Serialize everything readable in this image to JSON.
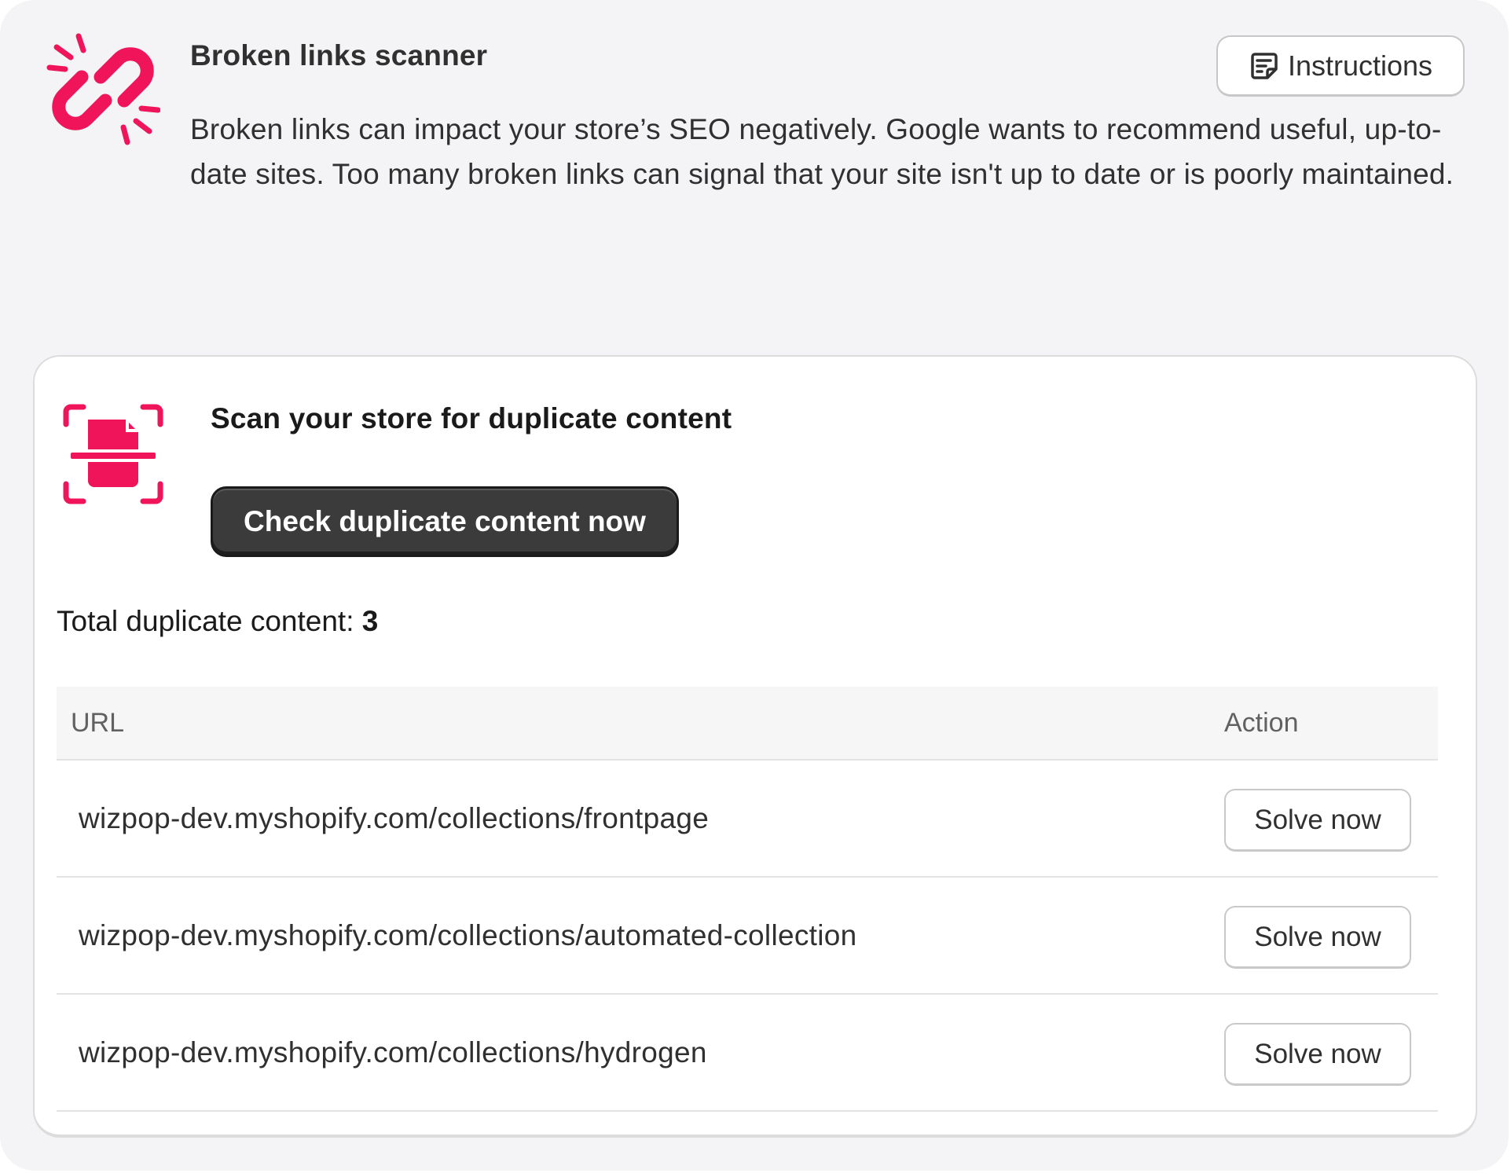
{
  "header": {
    "title": "Broken links scanner",
    "description": "Broken links can impact your store’s SEO negatively. Google wants to recommend useful, up-to-date sites. Too many broken links can signal that your site isn't up to date or is poorly maintained.",
    "instructions_label": "Instructions",
    "icon": "broken-link-icon"
  },
  "scan": {
    "title": "Scan your store for duplicate content",
    "button_label": "Check duplicate content now",
    "icon": "scan-document-icon",
    "total_label": "Total duplicate content:",
    "total_value": "3"
  },
  "table": {
    "columns": [
      "URL",
      "Action"
    ],
    "rows": [
      {
        "url": "wizpop-dev.myshopify.com/collections/frontpage",
        "action": "Solve now"
      },
      {
        "url": "wizpop-dev.myshopify.com/collections/automated-collection",
        "action": "Solve now"
      },
      {
        "url": "wizpop-dev.myshopify.com/collections/hydrogen",
        "action": "Solve now"
      }
    ]
  },
  "colors": {
    "accent": "#f0145a",
    "primary_button": "#3b3b3b",
    "background": "#f4f4f6"
  }
}
